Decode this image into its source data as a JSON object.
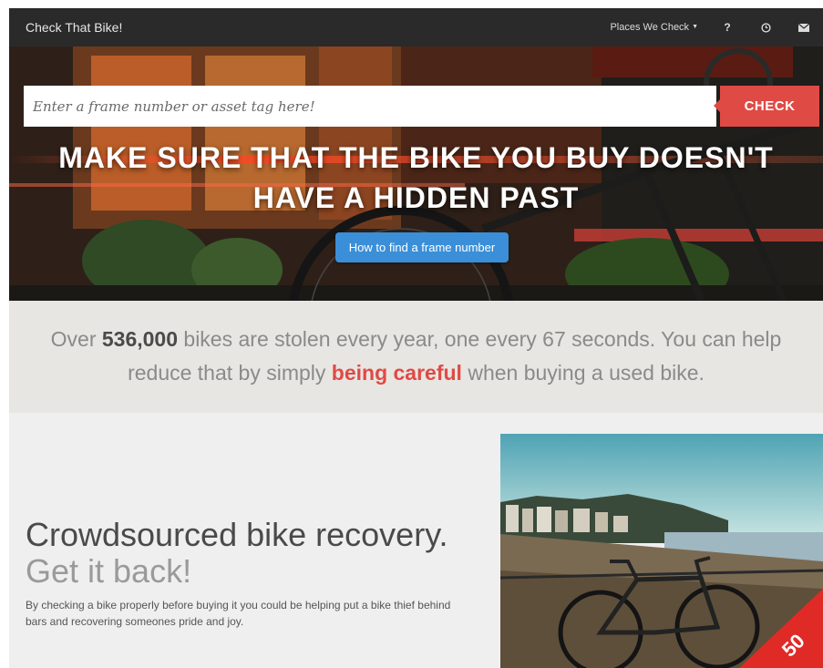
{
  "navbar": {
    "brand": "Check That Bike!",
    "places_label": "Places We Check",
    "icons": [
      "question-icon",
      "clock-icon",
      "mail-icon"
    ],
    "question_glyph": "?"
  },
  "hero": {
    "search_placeholder": "Enter a frame number or asset tag here!",
    "check_label": "CHECK",
    "headline": "MAKE SURE THAT THE BIKE YOU BUY DOESN'T HAVE A HIDDEN PAST",
    "frame_button": "How to find a frame number"
  },
  "stats": {
    "before_number": "Over ",
    "number": "536,000",
    "after_number": " bikes are stolen every year, one every 67 seconds. You can help reduce that by simply ",
    "emphasis": "being careful",
    "ending": " when buying a used bike."
  },
  "feature": {
    "title": "Crowdsourced bike recovery.",
    "subtitle": "Get it back!",
    "description": "By checking a bike properly before buying it you could be helping put a bike thief behind bars and recovering someones pride and joy."
  },
  "colors": {
    "accent_red": "#e04a45",
    "button_blue": "#3a8fd8",
    "navbar": "#2a2a2a"
  }
}
